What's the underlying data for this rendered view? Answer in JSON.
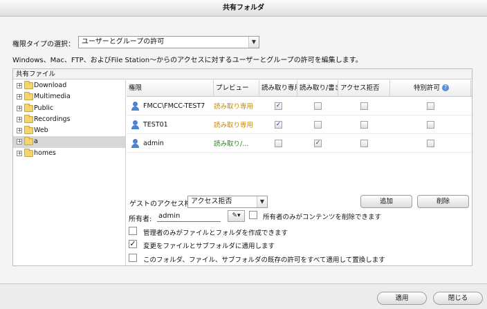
{
  "window": {
    "title": "共有フォルダ"
  },
  "permission_type": {
    "label": "権限タイプの選択：",
    "selected": "ユーザーとグループの許可",
    "description": "Windows、Mac、FTP、およびFile Station～からのアクセスに対するユーザーとグループの許可を編集します。"
  },
  "tree": {
    "header": "共有ファイル",
    "items": [
      {
        "label": "Download"
      },
      {
        "label": "Multimedia"
      },
      {
        "label": "Public"
      },
      {
        "label": "Recordings"
      },
      {
        "label": "Web"
      },
      {
        "label": "a",
        "selected": true
      },
      {
        "label": "homes"
      }
    ]
  },
  "grid": {
    "columns": {
      "name": "権限",
      "preview": "プレビュー",
      "read_only": "読み取り専用",
      "read_write": "読み取り/書き込み",
      "deny": "アクセス拒否",
      "special": "特別許可"
    },
    "rows": [
      {
        "name": "FMCC\\FMCC-TEST7",
        "preview": "読み取り専用",
        "preview_kind": "ro",
        "read_only": true,
        "read_write": false,
        "deny": false,
        "special": false
      },
      {
        "name": "TEST01",
        "preview": "読み取り専用",
        "preview_kind": "ro",
        "read_only": true,
        "read_write": false,
        "deny": false,
        "special": false
      },
      {
        "name": "admin",
        "preview": "読み取り/...",
        "preview_kind": "rw",
        "read_only": false,
        "read_write": true,
        "deny": false,
        "special": false
      }
    ]
  },
  "guest": {
    "label": "ゲストのアクセス権:",
    "selected": "アクセス拒否"
  },
  "buttons": {
    "add": "追加",
    "remove": "削除",
    "apply": "適用",
    "close": "閉じる"
  },
  "owner": {
    "label": "所有者:",
    "value": "admin"
  },
  "options": {
    "owner_delete_only": {
      "label": "所有者のみがコンテンツを削除できます",
      "checked": false
    },
    "admin_create_only": {
      "label": "管理者のみがファイルとフォルダを作成できます",
      "checked": false
    },
    "apply_to_subfolders": {
      "label": "変更をファイルとサブフォルダに適用します",
      "checked": true
    },
    "replace_all": {
      "label": "このフォルダ、ファイル、サブフォルダの既存の許可をすべて適用して置換します",
      "checked": false
    }
  },
  "icons": {
    "user": "user-icon",
    "folder": "folder-icon",
    "help": "help-icon",
    "edit": "edit-icon"
  }
}
